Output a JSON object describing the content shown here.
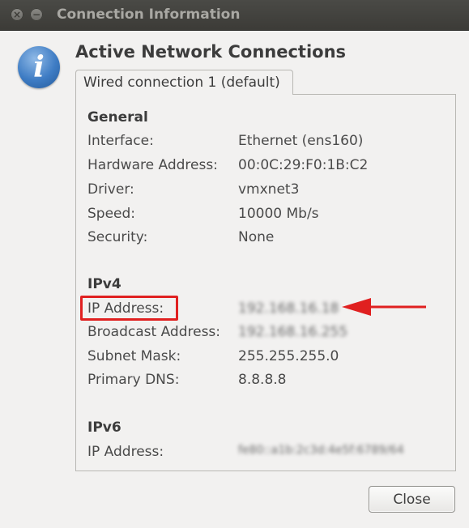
{
  "window": {
    "title": "Connection Information",
    "close_glyph": "×",
    "minimize_glyph": "−"
  },
  "info_icon_glyph": "i",
  "heading": "Active Network Connections",
  "tab": {
    "label": "Wired connection 1 (default)"
  },
  "sections": {
    "general": {
      "title": "General",
      "rows": [
        {
          "label": "Interface:",
          "value": "Ethernet (ens160)"
        },
        {
          "label": "Hardware Address:",
          "value": "00:0C:29:F0:1B:C2"
        },
        {
          "label": "Driver:",
          "value": "vmxnet3"
        },
        {
          "label": "Speed:",
          "value": "10000 Mb/s"
        },
        {
          "label": "Security:",
          "value": "None"
        }
      ]
    },
    "ipv4": {
      "title": "IPv4",
      "rows": [
        {
          "label": "IP Address:",
          "value": "192.168.16.18"
        },
        {
          "label": "Broadcast Address:",
          "value": "192.168.16.255"
        },
        {
          "label": "Subnet Mask:",
          "value": "255.255.255.0"
        },
        {
          "label": "Primary DNS:",
          "value": "8.8.8.8"
        }
      ]
    },
    "ipv6": {
      "title": "IPv6",
      "rows": [
        {
          "label": "IP Address:",
          "value": "fe80::a1b:2c3d:4e5f:6789/64"
        }
      ]
    }
  },
  "buttons": {
    "close": "Close"
  },
  "colors": {
    "annotation_red": "#e02020",
    "info_blue": "#3e7cc4",
    "titlebar": "#3c3b37"
  }
}
